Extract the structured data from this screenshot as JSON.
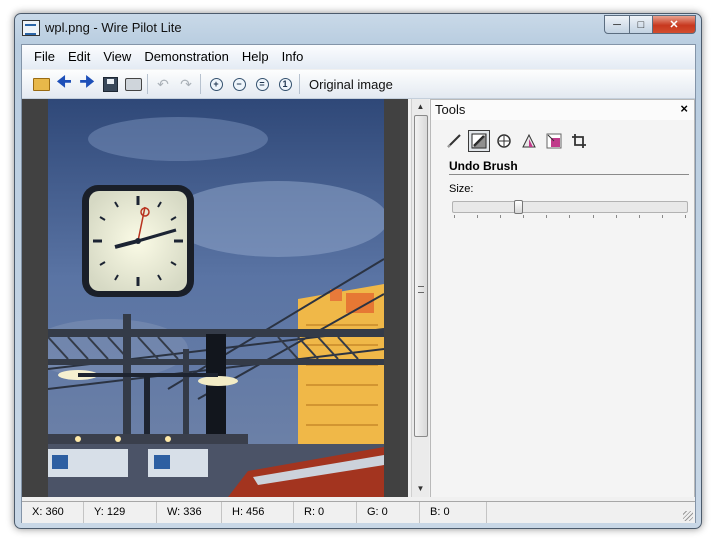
{
  "window": {
    "title": "wpl.png - Wire Pilot Lite"
  },
  "menu": [
    "File",
    "Edit",
    "View",
    "Demonstration",
    "Help",
    "Info"
  ],
  "toolbar": {
    "original_label": "Original image"
  },
  "tools_panel": {
    "title": "Tools",
    "close_glyph": "×",
    "section_title": "Undo Brush",
    "size_label": "Size:",
    "size_value": 0.27
  },
  "status": {
    "x": "X: 360",
    "y": "Y: 129",
    "w": "W: 336",
    "h": "H: 456",
    "r": "R: 0",
    "g": "G: 0",
    "b": "B: 0"
  },
  "icons": {
    "toolbar": [
      "open-folder-icon",
      "back-arrow-icon",
      "forward-arrow-icon",
      "save-icon",
      "print-icon",
      "undo-icon",
      "redo-icon",
      "zoom-in-icon",
      "zoom-out-icon",
      "zoom-fit-icon",
      "zoom-actual-icon"
    ],
    "tools": [
      "pencil-icon",
      "undo-brush-icon",
      "color-picker-icon",
      "gradient-icon",
      "resize-icon",
      "crop-icon"
    ]
  },
  "colors": {
    "window_frame": "#b9cde0",
    "sky": "#3f5580",
    "building": "#f0b848",
    "close_button": "#c7381f"
  }
}
